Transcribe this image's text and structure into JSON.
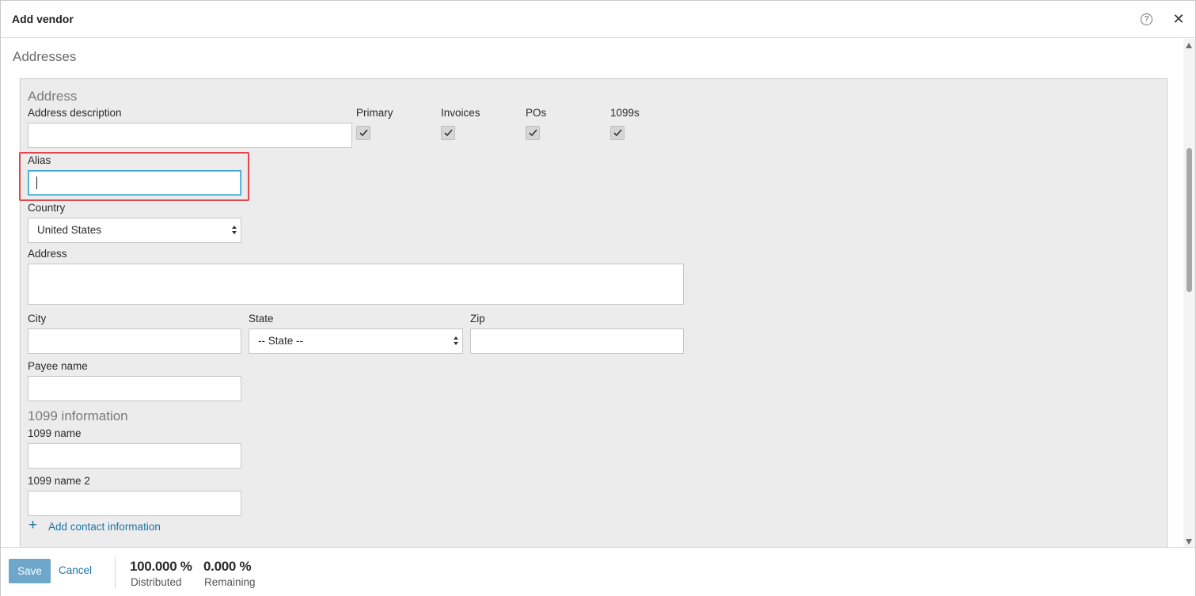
{
  "header": {
    "title": "Add vendor",
    "help_icon": "?",
    "close_icon": "✕"
  },
  "section": {
    "title": "Addresses"
  },
  "panel": {
    "title": "Address",
    "address_description_label": "Address description",
    "checkboxes": [
      {
        "label": "Primary",
        "checked": true
      },
      {
        "label": "Invoices",
        "checked": true
      },
      {
        "label": "POs",
        "checked": true
      },
      {
        "label": "1099s",
        "checked": true
      }
    ],
    "alias_label": "Alias",
    "alias_value": "",
    "country_label": "Country",
    "country_value": "United States",
    "address_label": "Address",
    "city_label": "City",
    "state_label": "State",
    "state_value": "-- State --",
    "zip_label": "Zip",
    "payee_label": "Payee name",
    "info_1099_title": "1099 information",
    "name_1099_label": "1099 name",
    "name_1099_2_label": "1099 name 2",
    "add_contact_label": "Add contact information"
  },
  "footer": {
    "save_label": "Save",
    "cancel_label": "Cancel",
    "distributed_value": "100.000 %",
    "distributed_label": "Distributed",
    "remaining_value": "0.000 %",
    "remaining_label": "Remaining"
  },
  "colors": {
    "accent": "#1d72a3",
    "save_button": "#6ea7c9",
    "highlight": "#e0474c",
    "panel_bg": "#ececec"
  }
}
